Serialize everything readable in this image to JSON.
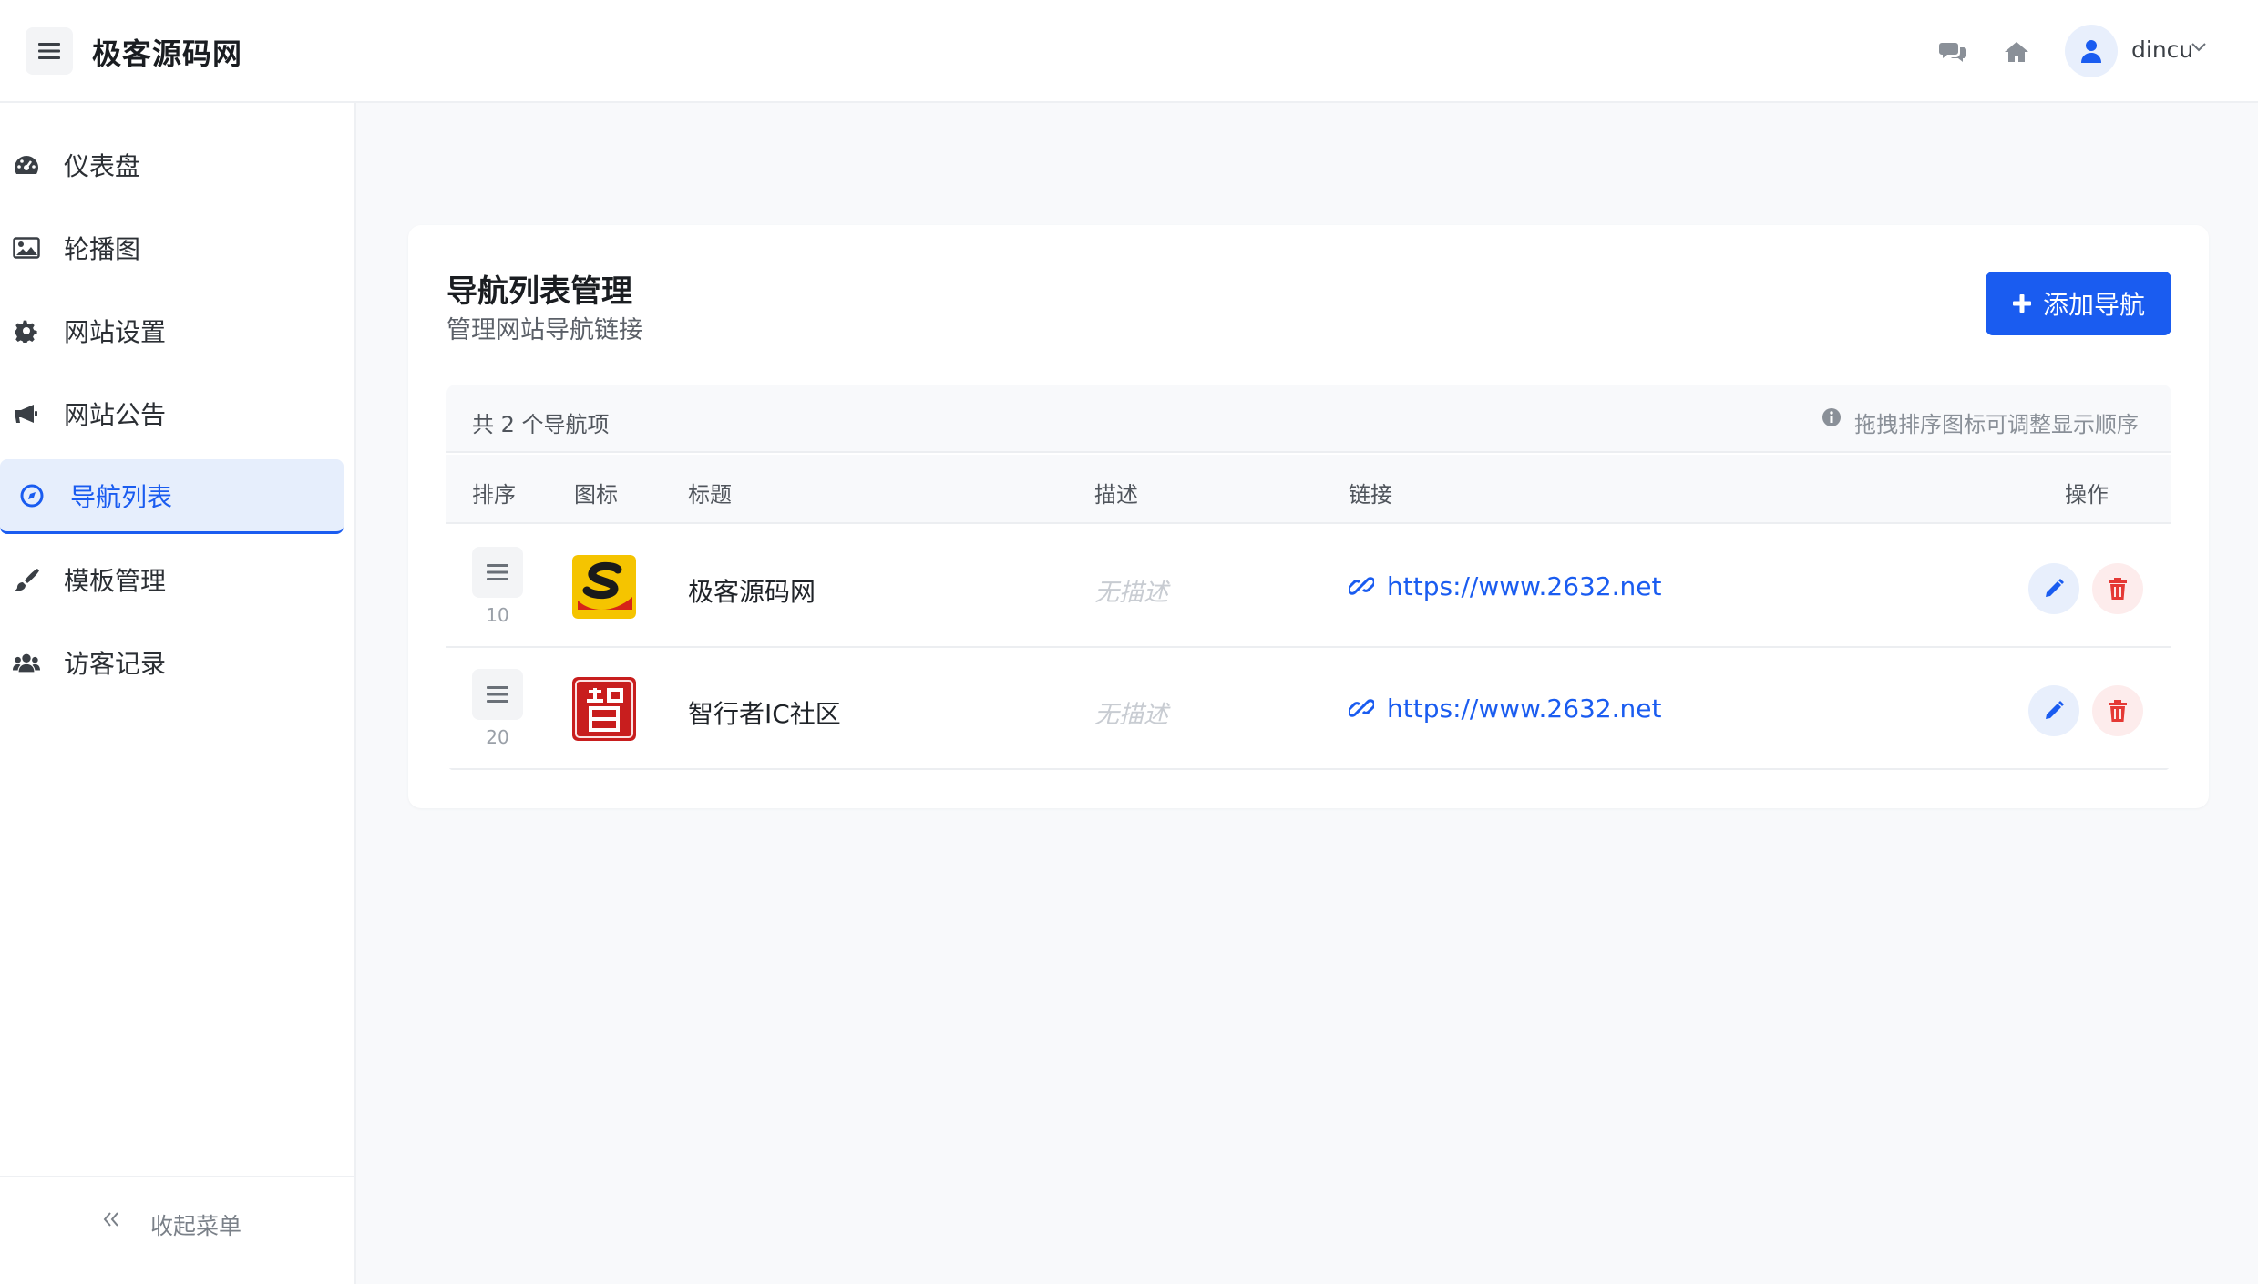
{
  "header": {
    "site_title": "极客源码网",
    "user_name": "dincu"
  },
  "sidebar": {
    "items": [
      {
        "label": "仪表盘",
        "icon": "dashboard-icon"
      },
      {
        "label": "轮播图",
        "icon": "image-icon"
      },
      {
        "label": "网站设置",
        "icon": "gear-icon"
      },
      {
        "label": "网站公告",
        "icon": "megaphone-icon"
      },
      {
        "label": "导航列表",
        "icon": "compass-icon",
        "active": true
      },
      {
        "label": "模板管理",
        "icon": "brush-icon"
      },
      {
        "label": "访客记录",
        "icon": "users-icon"
      }
    ],
    "collapse_label": "收起菜单"
  },
  "main": {
    "title": "导航列表管理",
    "subtitle": "管理网站导航链接",
    "add_button_label": "添加导航",
    "summary_count": "共 2 个导航项",
    "summary_hint": "拖拽排序图标可调整显示顺序",
    "columns": [
      "排序",
      "图标",
      "标题",
      "描述",
      "链接",
      "操作"
    ],
    "rows": [
      {
        "sort": "10",
        "title": "极客源码网",
        "description": "无描述",
        "link": "https://www.2632.net"
      },
      {
        "sort": "20",
        "title": "智行者IC社区",
        "description": "无描述",
        "link": "https://www.2632.net"
      }
    ]
  },
  "colors": {
    "accent": "#1a5cf0",
    "active_bg": "#e6eefc",
    "danger": "#e53935"
  }
}
